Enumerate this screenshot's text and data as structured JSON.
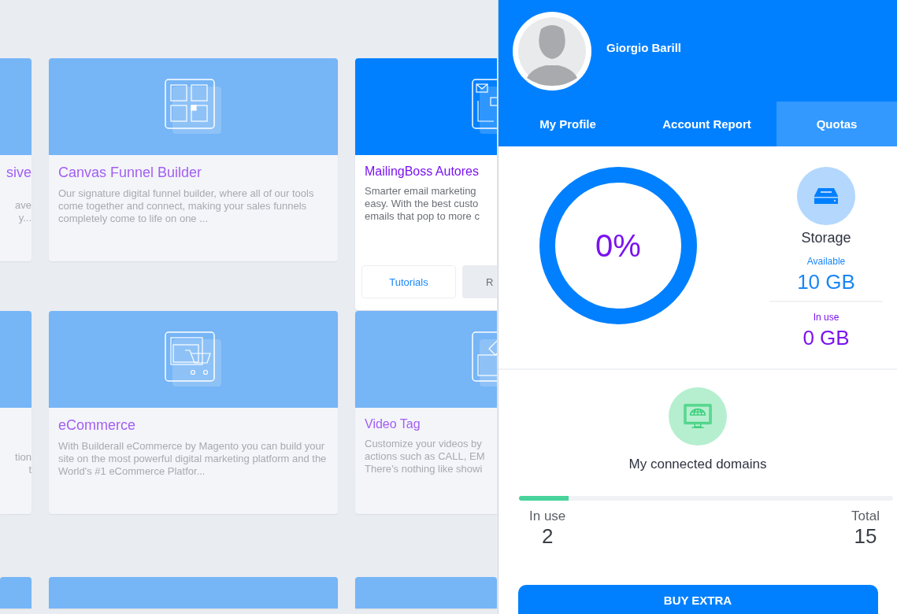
{
  "cards": [
    {
      "kind": "cut_left",
      "title": "sive",
      "lines": [
        "ave",
        "y..."
      ]
    },
    {
      "kind": "full",
      "title": "Canvas Funnel Builder",
      "description": "Our signature digital funnel builder, where all of our tools come together and connect, making your sales funnels completely come to life on one ..."
    },
    {
      "kind": "hovered",
      "title": "MailingBoss Autores",
      "lines": [
        "Smarter email marketing",
        "easy. With the best custo",
        "emails that pop to more c"
      ],
      "buttons": [
        "Tutorials",
        "R"
      ]
    },
    {
      "kind": "cut_left",
      "lines": [
        "tion",
        "t"
      ]
    },
    {
      "kind": "full",
      "title": "eCommerce",
      "description": "With Builderall eCommerce by Magento you can build your site on the most powerful digital marketing platform and the World's #1 eCommerce Platfor..."
    },
    {
      "kind": "cut_right",
      "title": "Video Tag",
      "lines": [
        "Customize your videos by",
        "actions such as CALL, EM",
        "There’s nothing like showi"
      ]
    },
    {
      "kind": "stub"
    },
    {
      "kind": "stub"
    },
    {
      "kind": "stub"
    }
  ],
  "panel": {
    "user_name": "Giorgio Barill",
    "tabs": [
      {
        "label": "My Profile",
        "selected": false
      },
      {
        "label": "Account Report",
        "selected": false
      },
      {
        "label": "Quotas",
        "selected": true
      }
    ],
    "storage": {
      "percent": "0%",
      "title": "Storage",
      "available_label": "Available",
      "available": "10 GB",
      "in_use_label": "In use",
      "in_use": "0 GB"
    },
    "domains": {
      "title": "My connected domains",
      "level": 0.133,
      "in_use_label": "In use",
      "in_use": "2",
      "total_label": "Total",
      "total": "15"
    },
    "button": "BUY EXTRA"
  }
}
